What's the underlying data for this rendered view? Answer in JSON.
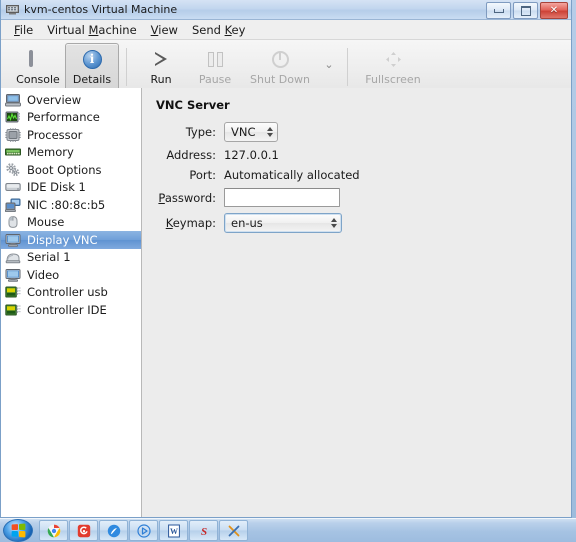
{
  "window": {
    "title": "kvm-centos Virtual Machine",
    "icon": "vm-icon",
    "buttons": {
      "minimize": "minimize-button",
      "maximize": "maximize-button",
      "close": "✕"
    }
  },
  "menubar": {
    "items": [
      {
        "pre": "",
        "acc": "F",
        "post": "ile"
      },
      {
        "pre": "Virtual ",
        "acc": "M",
        "post": "achine"
      },
      {
        "pre": "",
        "acc": "V",
        "post": "iew"
      },
      {
        "pre": "Send ",
        "acc": "K",
        "post": "ey"
      }
    ]
  },
  "toolbar": {
    "buttons": [
      {
        "label": "Console",
        "icon": "monitor-icon",
        "state": "enabled",
        "active": false
      },
      {
        "label": "Details",
        "icon": "info-icon",
        "state": "enabled",
        "active": true
      },
      {
        "label": "Run",
        "icon": "play-icon",
        "state": "enabled",
        "active": false
      },
      {
        "label": "Pause",
        "icon": "pause-icon",
        "state": "disabled",
        "active": false
      },
      {
        "label": "Shut Down",
        "icon": "power-icon",
        "state": "disabled",
        "active": false
      },
      {
        "label": "Fullscreen",
        "icon": "fullscreen-icon",
        "state": "disabled",
        "active": false
      }
    ],
    "dropdown_caret": "⌄"
  },
  "sidebar": {
    "selected": "Display VNC",
    "items": [
      {
        "label": "Overview",
        "icon": "computer-icon"
      },
      {
        "label": "Performance",
        "icon": "performance-chart-icon"
      },
      {
        "label": "Processor",
        "icon": "cpu-icon"
      },
      {
        "label": "Memory",
        "icon": "memory-icon"
      },
      {
        "label": "Boot Options",
        "icon": "gears-icon"
      },
      {
        "label": "IDE Disk 1",
        "icon": "disk-icon"
      },
      {
        "label": "NIC :80:8c:b5",
        "icon": "network-icon"
      },
      {
        "label": "Mouse",
        "icon": "mouse-icon"
      },
      {
        "label": "Display VNC",
        "icon": "display-icon"
      },
      {
        "label": "Serial 1",
        "icon": "serial-icon"
      },
      {
        "label": "Video",
        "icon": "video-icon"
      },
      {
        "label": "Controller usb",
        "icon": "controller-icon"
      },
      {
        "label": "Controller IDE",
        "icon": "controller-icon"
      }
    ]
  },
  "main": {
    "section_title": "VNC Server",
    "fields": {
      "type": {
        "label": "Type:",
        "value": "VNC"
      },
      "address": {
        "label": "Address:",
        "value": "127.0.0.1"
      },
      "port": {
        "label": "Port:",
        "value": "Automatically allocated"
      },
      "password": {
        "label_pre": "",
        "label_acc": "P",
        "label_post": "assword:",
        "value": "",
        "placeholder": ""
      },
      "keymap": {
        "label_pre": "",
        "label_acc": "K",
        "label_post": "eymap:",
        "value": "en-us"
      }
    }
  },
  "taskbar": {
    "start_button": "start-orb",
    "items": [
      {
        "name": "chrome-icon",
        "glyph": "◉",
        "color": "#4285F4"
      },
      {
        "name": "recorder-icon",
        "glyph": "@",
        "color": "#e23b2e"
      },
      {
        "name": "browser-icon",
        "glyph": "●",
        "color": "#2f8ae0"
      },
      {
        "name": "media-player-icon",
        "glyph": "▷",
        "color": "#2f7fd6"
      },
      {
        "name": "word-icon",
        "glyph": "W",
        "color": "#2a5699"
      },
      {
        "name": "snagit-icon",
        "glyph": "S",
        "color": "#c62828"
      },
      {
        "name": "tool-icon",
        "glyph": "✕",
        "color": "#e09018"
      }
    ]
  },
  "colors": {
    "accent": "#6f9fd8",
    "window_bg": "#ececec",
    "desktop": "#a6c2e0",
    "close_red": "#cd4237"
  }
}
